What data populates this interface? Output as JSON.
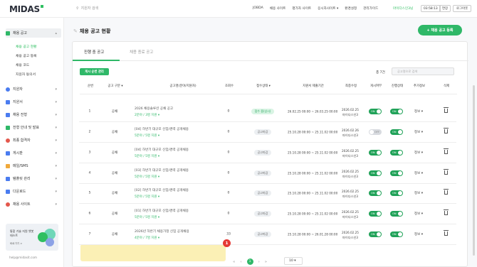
{
  "topbar": {
    "logo": "MIDAS",
    "search_placeholder": "지원자 검색",
    "nav": [
      "JOBDA",
      "채용 사이트",
      "평가자 사이트",
      "응시자사이트 ▾",
      "환경설정",
      "관리가이드"
    ],
    "user": "마이다스인3님",
    "timer": "03:58:13",
    "extend": "연장",
    "logout": "로그아웃"
  },
  "sidebar": {
    "items": [
      {
        "label": "채용 공고",
        "chev": "▴",
        "color": "#2fb868"
      },
      {
        "label": "지원자",
        "chev": "▾",
        "color": "#4a7cf0"
      },
      {
        "label": "지원서",
        "chev": "▾",
        "color": "#4a7cf0"
      },
      {
        "label": "채용 전형",
        "chev": "▾",
        "color": "#4a7cf0"
      },
      {
        "label": "전형 안내 및 발표",
        "chev": "▾",
        "color": "#2fb868"
      },
      {
        "label": "최종 합격자",
        "chev": "▾",
        "color": "#e4574c"
      },
      {
        "label": "게시판",
        "chev": "▾",
        "color": "#4a7cf0"
      },
      {
        "label": "메일/SMS",
        "chev": "▾",
        "color": "#f0a93b"
      },
      {
        "label": "템플릿 관리",
        "chev": "▾",
        "color": "#4a7cf0"
      },
      {
        "label": "다운로드",
        "chev": "▾",
        "color": "#4a7cf0"
      },
      {
        "label": "채용 사이트",
        "chev": "▾",
        "color": "#e4574c"
      }
    ],
    "subitems": [
      "채용 공고 현황",
      "채용 공고 등록",
      "채용 코드",
      "지원자 동의서"
    ],
    "promo_title": "통합 기술 지원 챗봇 테스트",
    "promo_btn": "바로가기 >",
    "email": "help@midasit.com"
  },
  "page": {
    "title": "채용 공고 현황",
    "register_button": "+ 채용 공고 등록",
    "tabs": [
      "진행 중 공고",
      "채용 종료 공고"
    ],
    "settings_button": "게시 순번 관리",
    "total": "총 7건",
    "search_placeholder": "공고명으로 검색"
  },
  "table": {
    "headers": [
      "순번",
      "공고 구분 ▾",
      "공고명(분야/지원자)",
      "조회수",
      "접수상태 ▾",
      "지원서 제출기간",
      "최종수정",
      "게시여부",
      "진행상태",
      "추가정보",
      "삭제"
    ],
    "rows": [
      {
        "num": "1",
        "type": "공채",
        "title": "2026 채용솔루션 공채 공고",
        "sub": "2분야 / 3명 지원 ▾",
        "views": "0",
        "status": "접수 중(상시)",
        "period": "26.02.25 00:00 ~ 26.03.25 00:00",
        "mod_date": "2026.02.25",
        "mod_user": "마이다스인3",
        "post": "ON",
        "progress": "ON",
        "info": "정보 ▾"
      },
      {
        "num": "2",
        "type": "공채",
        "title": "[04] 하반기 대규모 신입/경력 공개채용",
        "sub": "5분야 / 5명 지원 ▾",
        "views": "0",
        "status": "공고마감",
        "period": "25.10.28 00:00 ~ 25.11.02 00:00",
        "mod_date": "2026.02.26",
        "mod_user": "마이다스인3",
        "post": "OFF",
        "progress": "ON",
        "info": "정보 ▾"
      },
      {
        "num": "3",
        "type": "공채",
        "title": "[04] 하반기 대규모 신입/경력 공개채용",
        "sub": "5분야 / 5명 지원 ▾",
        "views": "0",
        "status": "공고마감",
        "period": "25.10.28 00:00 ~ 25.11.02 00:00",
        "mod_date": "2026.02.25",
        "mod_user": "마이다스인3",
        "post": "ON",
        "progress": "ON",
        "info": "정보 ▾"
      },
      {
        "num": "4",
        "type": "공채",
        "title": "[03] 하반기 대규모 신입/경력 공개채용",
        "sub": "5분야 / 5명 지원 ▾",
        "views": "0",
        "status": "공고마감",
        "period": "25.10.28 00:00 ~ 25.11.02 00:00",
        "mod_date": "2026.02.25",
        "mod_user": "마이다스인3",
        "post": "ON",
        "progress": "ON",
        "info": "정보 ▾"
      },
      {
        "num": "5",
        "type": "공채",
        "title": "[02] 하반기 대규모 신입/경력 공개채용",
        "sub": "5분야 / 5명 지원 ▾",
        "views": "0",
        "status": "공고마감",
        "period": "25.10.28 00:00 ~ 25.11.02 00:00",
        "mod_date": "2026.02.25",
        "mod_user": "마이다스인3",
        "post": "ON",
        "progress": "ON",
        "info": "정보 ▾"
      },
      {
        "num": "6",
        "type": "공채",
        "title": "[01] 하반기 대규모 신입/경력 공개채용",
        "sub": "5분야 / 5명 지원 ▾",
        "views": "0",
        "status": "공고마감",
        "period": "25.10.28 00:00 ~ 25.11.02 00:00",
        "mod_date": "2026.02.25",
        "mod_user": "마이다스인3",
        "post": "ON",
        "progress": "ON",
        "info": "정보 ▾"
      },
      {
        "num": "7",
        "type": "공채",
        "title": "2026년 하반기 채용가정 신입 공개채용",
        "sub": "4분야 / 7명 지원 ▾",
        "views": "33",
        "status": "공고마감",
        "period": "25.10.28 00:00 ~ 26.01.28 00:00",
        "mod_date": "2026.02.25",
        "mod_user": "마이다스인3",
        "post": "ON",
        "progress": "ON",
        "info": "정보 ▾"
      }
    ]
  },
  "annotation_badge": "1",
  "pager": {
    "first": "«",
    "prev": "‹",
    "current": "1",
    "next": "›",
    "last": "»",
    "page_size": "10 ▾"
  }
}
